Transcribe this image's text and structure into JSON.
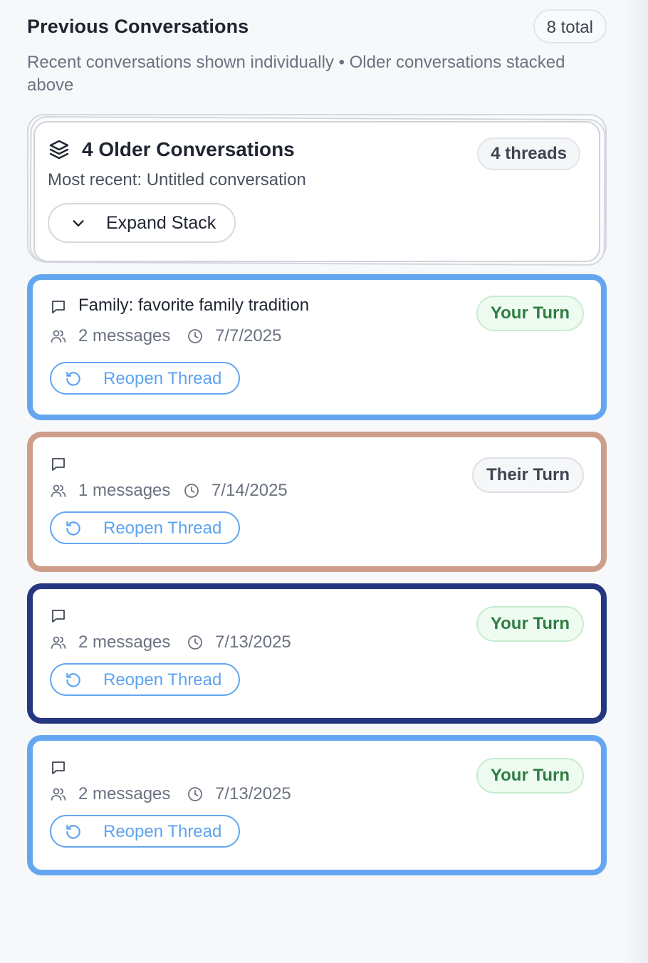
{
  "header": {
    "title": "Previous Conversations",
    "total": "8 total",
    "subtitle": "Recent conversations shown individually • Older conversations stacked above"
  },
  "stack": {
    "icon": "layers-icon",
    "title": "4 Older Conversations",
    "threads": "4 threads",
    "most_recent": "Most recent: Untitled conversation",
    "expand_label": "Expand Stack"
  },
  "conversations": [
    {
      "title": "Family: favorite family tradition",
      "messages": "2 messages",
      "date": "7/7/2025",
      "turn": "Your Turn",
      "reopen": "Reopen Thread",
      "border_color": "#64a7f0"
    },
    {
      "title": "",
      "messages": "1 messages",
      "date": "7/14/2025",
      "turn": "Their Turn",
      "reopen": "Reopen Thread",
      "border_color": "#cd9f8a"
    },
    {
      "title": "",
      "messages": "2 messages",
      "date": "7/13/2025",
      "turn": "Your Turn",
      "reopen": "Reopen Thread",
      "border_color": "#263781"
    },
    {
      "title": "",
      "messages": "2 messages",
      "date": "7/13/2025",
      "turn": "Your Turn",
      "reopen": "Reopen Thread",
      "border_color": "#64a7f0"
    }
  ],
  "colors": {
    "your_turn_text": "#2f7d42",
    "your_turn_bg": "#eefbf1",
    "reopen_accent": "#5ea3ef"
  }
}
